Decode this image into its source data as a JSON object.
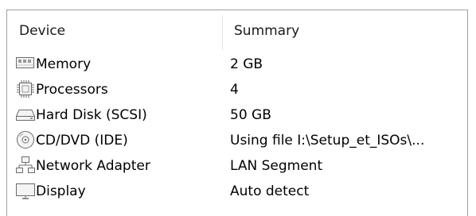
{
  "table": {
    "headers": {
      "device": "Device",
      "summary": "Summary"
    },
    "rows": [
      {
        "icon": "memory-icon",
        "device": "Memory",
        "summary": "2 GB"
      },
      {
        "icon": "processor-icon",
        "device": "Processors",
        "summary": "4"
      },
      {
        "icon": "hard-disk-icon",
        "device": "Hard Disk (SCSI)",
        "summary": "50 GB"
      },
      {
        "icon": "cd-dvd-icon",
        "device": "CD/DVD (IDE)",
        "summary": "Using file I:\\Setup_et_ISOs\\..."
      },
      {
        "icon": "network-adapter-icon",
        "device": "Network Adapter",
        "summary": "LAN Segment"
      },
      {
        "icon": "display-icon",
        "device": "Display",
        "summary": "Auto detect"
      }
    ]
  },
  "colors": {
    "border": "#a0a0a0",
    "icon_stroke": "#6b6b6b",
    "text": "#000000"
  }
}
